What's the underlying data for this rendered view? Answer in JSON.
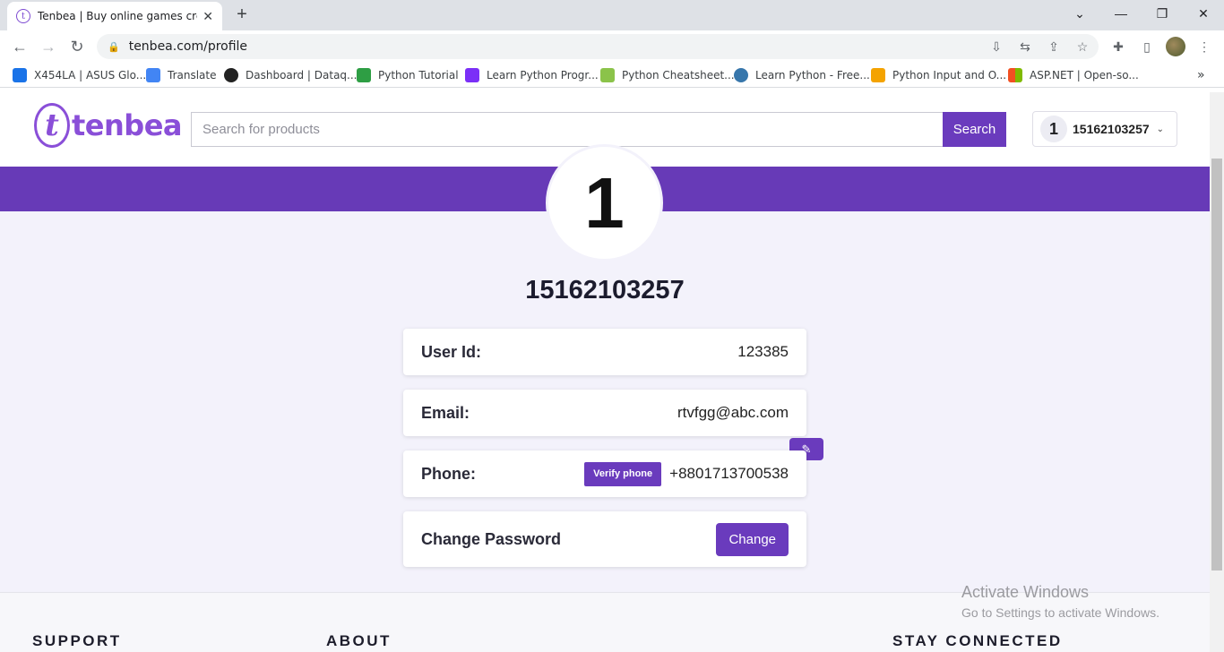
{
  "browser": {
    "tab_title": "Tenbea | Buy online games credit",
    "url": "tenbea.com/profile",
    "bookmarks": [
      {
        "label": "X454LA | ASUS Glo...",
        "color": "#1a73e8"
      },
      {
        "label": "Translate",
        "color": "#4285f4"
      },
      {
        "label": "Dashboard | Dataq...",
        "color": "#222222"
      },
      {
        "label": "Python Tutorial",
        "color": "#2e9e44"
      },
      {
        "label": "Learn Python Progr...",
        "color": "#7b2ff7"
      },
      {
        "label": "Python Cheatsheet...",
        "color": "#8bc34a"
      },
      {
        "label": "Learn Python - Free...",
        "color": "#3776ab"
      },
      {
        "label": "Python Input and O...",
        "color": "#f4a300"
      },
      {
        "label": "ASP.NET | Open-so...",
        "color": "#f25022"
      }
    ]
  },
  "header": {
    "logo_text": "tenbea",
    "search_placeholder": "Search for products",
    "search_button": "Search",
    "user_avatar": "1",
    "user_name": "15162103257"
  },
  "profile": {
    "avatar_letter": "1",
    "name": "15162103257",
    "user_id_label": "User Id:",
    "user_id": "123385",
    "email_label": "Email:",
    "email": "rtvfgg@abc.com",
    "phone_label": "Phone:",
    "verify_phone": "Verify phone",
    "phone": "+8801713700538",
    "change_password_label": "Change Password",
    "change_button": "Change"
  },
  "footer": {
    "support": "SUPPORT",
    "about": "ABOUT",
    "stay_connected": "STAY CONNECTED"
  },
  "watermark": {
    "line1": "Activate Windows",
    "line2": "Go to Settings to activate Windows."
  },
  "colors": {
    "brand": "#673ab7",
    "button": "#6a3bbd",
    "page_bg": "#f3f2fb"
  }
}
